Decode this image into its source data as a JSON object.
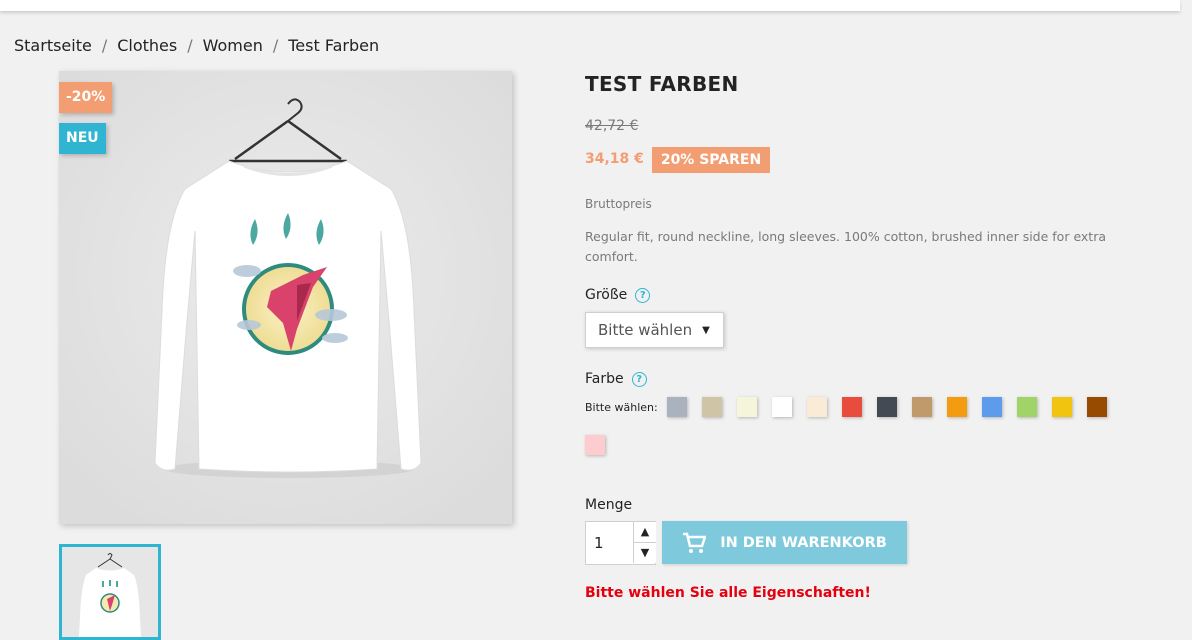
{
  "breadcrumb": [
    "Startseite",
    "Clothes",
    "Women",
    "Test Farben"
  ],
  "product": {
    "flags": {
      "discount": "-20%",
      "new": "NEU"
    },
    "title": "TEST FARBEN",
    "regular_price": "42,72 €",
    "current_price": "34,18 €",
    "save_badge": "20% SPAREN",
    "tax_label": "Bruttopreis",
    "description": "Regular fit, round neckline, long sleeves. 100% cotton, brushed inner side for extra comfort."
  },
  "variants": {
    "size_label": "Größe",
    "size_select_value": "Bitte wählen",
    "color_label": "Farbe",
    "color_hint": "Bitte wählen:",
    "help_icon": "question-circle-icon",
    "colors": [
      "#aab2bd",
      "#cfc4a6",
      "#f5f5dc",
      "#ffffff",
      "#faebd7",
      "#e84c3d",
      "#434a54",
      "#c19a6b",
      "#f39c11",
      "#5d9cec",
      "#a0d468",
      "#f1c40f",
      "#964b00",
      "#fcccce"
    ]
  },
  "quantity": {
    "label": "Menge",
    "value": "1"
  },
  "cart_button": {
    "label": "IN DEN WARENKORB",
    "icon": "shopping-cart-icon"
  },
  "error_message": "Bitte wählen Sie alle Eigenschaften!",
  "colors": {
    "accent": "#2fb5d2",
    "discount": "#f39d72",
    "error": "#e3000f",
    "button": "#7fc9dd"
  }
}
